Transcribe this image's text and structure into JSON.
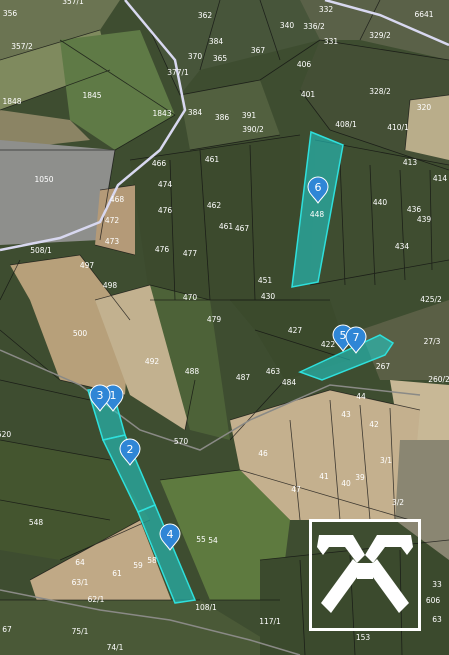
{
  "map": {
    "parcel_labels": [
      "356",
      "357/1",
      "362",
      "357/2",
      "332",
      "340",
      "336/2",
      "331",
      "329/2",
      "384",
      "367",
      "377/1",
      "370",
      "365",
      "6641",
      "1848",
      "1845",
      "1843",
      "384",
      "386",
      "391",
      "390/2",
      "406",
      "401",
      "328/2",
      "320",
      "1050",
      "466",
      "461",
      "408/1",
      "410/1",
      "413",
      "414",
      "468",
      "474",
      "476",
      "462",
      "461",
      "467",
      "440",
      "448",
      "439",
      "436",
      "472",
      "473",
      "508/1",
      "497",
      "476",
      "477",
      "434",
      "498",
      "500",
      "492",
      "488",
      "470",
      "479",
      "451",
      "430",
      "425/2",
      "427",
      "422",
      "27/3",
      "487",
      "463",
      "484",
      "267",
      "260/2",
      "570",
      "46",
      "44",
      "43",
      "42",
      "47",
      "41",
      "40",
      "39",
      "3/1",
      "3/2",
      "548",
      "58",
      "59",
      "61",
      "55",
      "54",
      "64",
      "63/1",
      "62/1",
      "67",
      "75/1",
      "74/1",
      "108/1",
      "117/1",
      "153",
      "33",
      "606",
      "63",
      "520"
    ],
    "markers": [
      "1",
      "2",
      "3",
      "4",
      "5",
      "6",
      "7"
    ]
  },
  "colors": {
    "highlight_fill": "#22c8c4",
    "highlight_stroke": "#2ee0dc",
    "marker": "#2f86d6",
    "boundary": "#111111",
    "road": "#d8d8f0"
  },
  "logo": {
    "icon": "crossed-gables-icon"
  }
}
